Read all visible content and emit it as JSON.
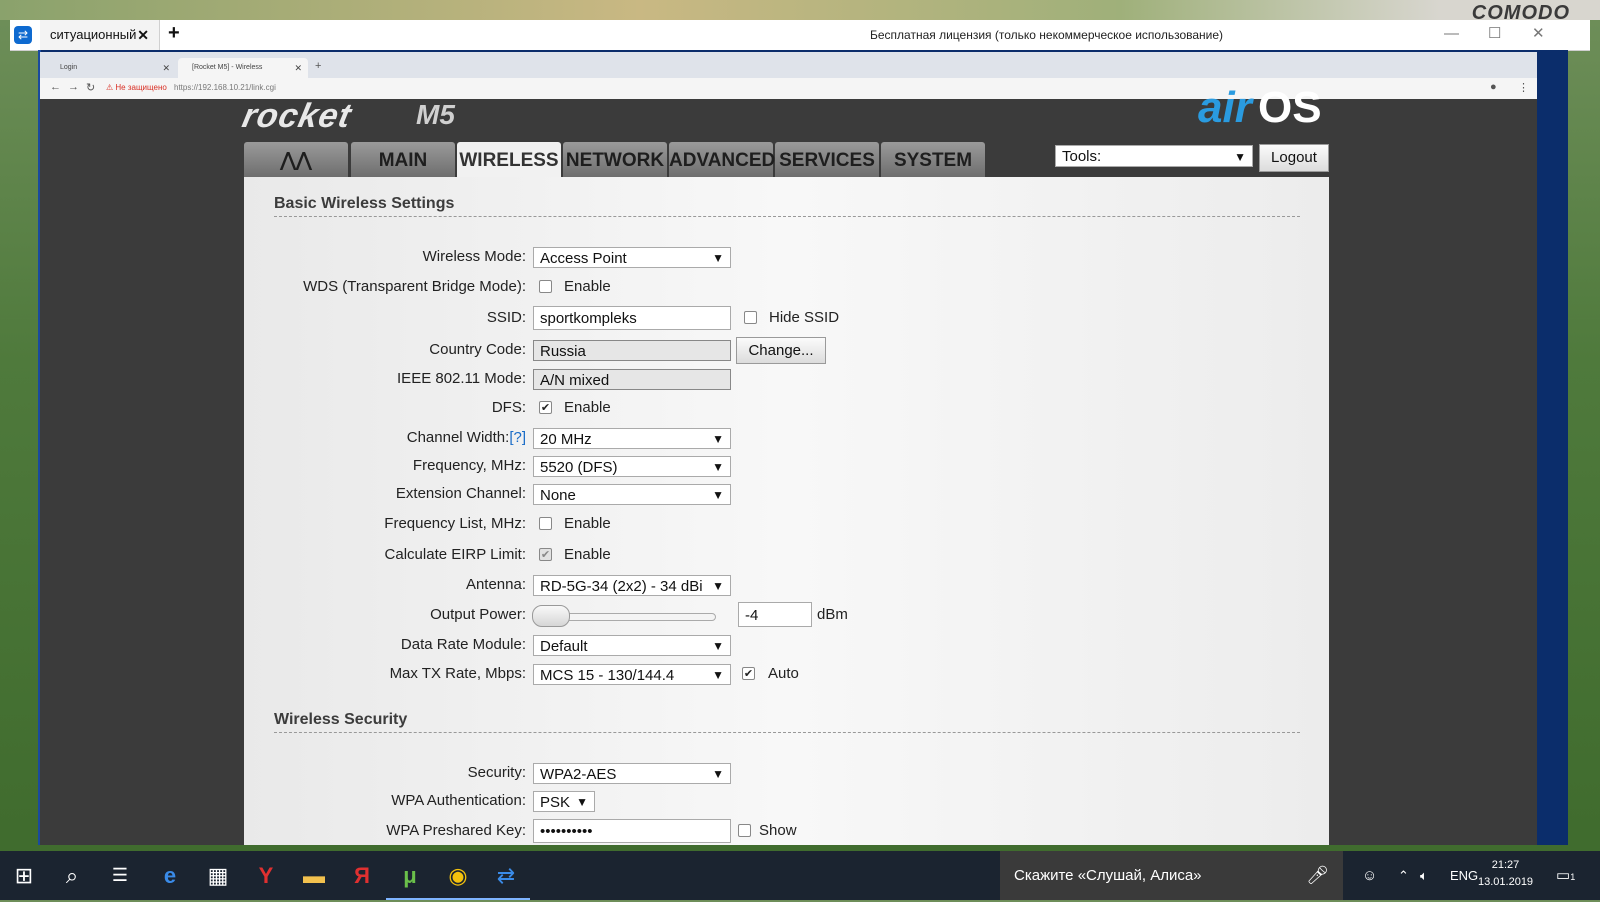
{
  "desktop": {
    "brand": "COMODO"
  },
  "remote_window": {
    "tab_label": "ситуационный",
    "title": "Бесплатная лицензия (только некоммерческое использование)"
  },
  "browser": {
    "tabs": [
      {
        "label": "Login"
      },
      {
        "label": "[Rocket M5] - Wireless"
      }
    ],
    "security_warning": "Не защищено",
    "url": "https://192.168.10.21/link.cgi"
  },
  "router": {
    "brand": "rocket",
    "model": "M5",
    "os_brand_a": "air",
    "os_brand_b": "OS",
    "nav_tabs": [
      "MAIN",
      "WIRELESS",
      "NETWORK",
      "ADVANCED",
      "SERVICES",
      "SYSTEM"
    ],
    "active_tab": "WIRELESS",
    "tools_label": "Tools:",
    "logout_label": "Logout"
  },
  "basic": {
    "title": "Basic Wireless Settings",
    "wireless_mode": {
      "label": "Wireless Mode:",
      "value": "Access Point"
    },
    "wds": {
      "label": "WDS (Transparent Bridge Mode):",
      "option": "Enable",
      "checked": false
    },
    "ssid": {
      "label": "SSID:",
      "value": "sportkompleks",
      "hide_label": "Hide SSID",
      "hide_checked": false
    },
    "country": {
      "label": "Country Code:",
      "value": "Russia",
      "button": "Change..."
    },
    "ieee": {
      "label": "IEEE 802.11 Mode:",
      "value": "A/N mixed"
    },
    "dfs": {
      "label": "DFS:",
      "option": "Enable",
      "checked": true
    },
    "channel_width": {
      "label": "Channel Width:",
      "help": "[?]",
      "value": "20 MHz"
    },
    "frequency": {
      "label": "Frequency, MHz:",
      "value": "5520 (DFS)"
    },
    "extension": {
      "label": "Extension Channel:",
      "value": "None"
    },
    "freq_list": {
      "label": "Frequency List, MHz:",
      "option": "Enable",
      "checked": false
    },
    "eirp": {
      "label": "Calculate EIRP Limit:",
      "option": "Enable",
      "checked": true
    },
    "antenna": {
      "label": "Antenna:",
      "value": "RD-5G-34 (2x2) - 34 dBi"
    },
    "output_power": {
      "label": "Output Power:",
      "value": "-4",
      "unit": "dBm"
    },
    "data_rate": {
      "label": "Data Rate Module:",
      "value": "Default"
    },
    "max_tx": {
      "label": "Max TX Rate, Mbps:",
      "value": "MCS 15 - 130/144.4",
      "auto_label": "Auto",
      "auto_checked": true
    }
  },
  "security": {
    "title": "Wireless Security",
    "security": {
      "label": "Security:",
      "value": "WPA2-AES"
    },
    "wpa_auth": {
      "label": "WPA Authentication:",
      "value": "PSK"
    },
    "psk": {
      "label": "WPA Preshared Key:",
      "value": "••••••••••",
      "show_label": "Show"
    }
  },
  "taskbar": {
    "search_text": "Скажите «Слушай, Алиса»",
    "lang": "ENG",
    "time": "21:27",
    "date": "13.01.2019",
    "notifications": "1"
  },
  "colors": {
    "accent": "#2a9be0",
    "taskbar": "#1b2430",
    "panel": "#f1f1f1"
  }
}
